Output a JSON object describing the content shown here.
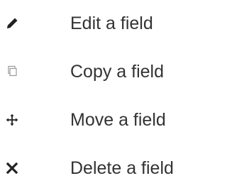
{
  "menu": {
    "items": [
      {
        "label": "Edit a field",
        "icon": "pencil-icon"
      },
      {
        "label": "Copy a field",
        "icon": "copy-icon"
      },
      {
        "label": "Move a field",
        "icon": "move-icon"
      },
      {
        "label": "Delete a field",
        "icon": "close-icon"
      }
    ]
  },
  "colors": {
    "text": "#333333",
    "icon_dark": "#222222",
    "icon_light": "#9a9a9a"
  }
}
